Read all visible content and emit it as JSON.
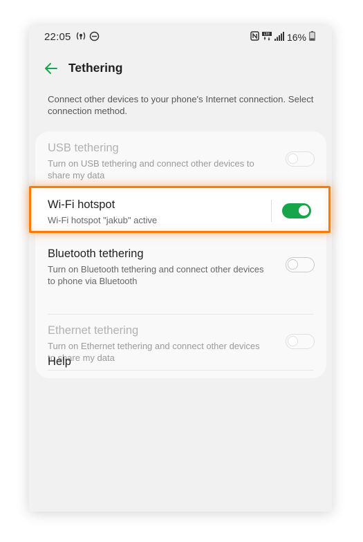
{
  "status_bar": {
    "time": "22:05",
    "left_icons": [
      "wifi-calling-icon",
      "do-not-disturb-icon"
    ],
    "right_icons": [
      "nfc-icon",
      "lte-icon",
      "signal-icon"
    ],
    "battery_text": "16%"
  },
  "app_bar": {
    "title": "Tethering",
    "back_icon": "arrow-left-icon"
  },
  "description": "Connect other devices to your phone's Internet connection. Select connection method.",
  "accent_color": "#17a54a",
  "highlight_color": "#ff7a00",
  "settings": [
    {
      "title": "USB tethering",
      "subtitle": "Turn on USB tethering and connect other devices to share my data",
      "toggle_on": false,
      "enabled": false
    },
    {
      "title": "Wi-Fi hotspot",
      "subtitle": "Wi-Fi hotspot \"jakub\" active",
      "toggle_on": true,
      "enabled": true
    },
    {
      "title": "Bluetooth tethering",
      "subtitle": "Turn on Bluetooth tethering and connect other devices to phone via Bluetooth",
      "toggle_on": false,
      "enabled": true
    },
    {
      "title": "Ethernet tethering",
      "subtitle": "Turn on Ethernet tethering and connect other devices to share my data",
      "toggle_on": false,
      "enabled": false
    }
  ],
  "help_label": "Help"
}
